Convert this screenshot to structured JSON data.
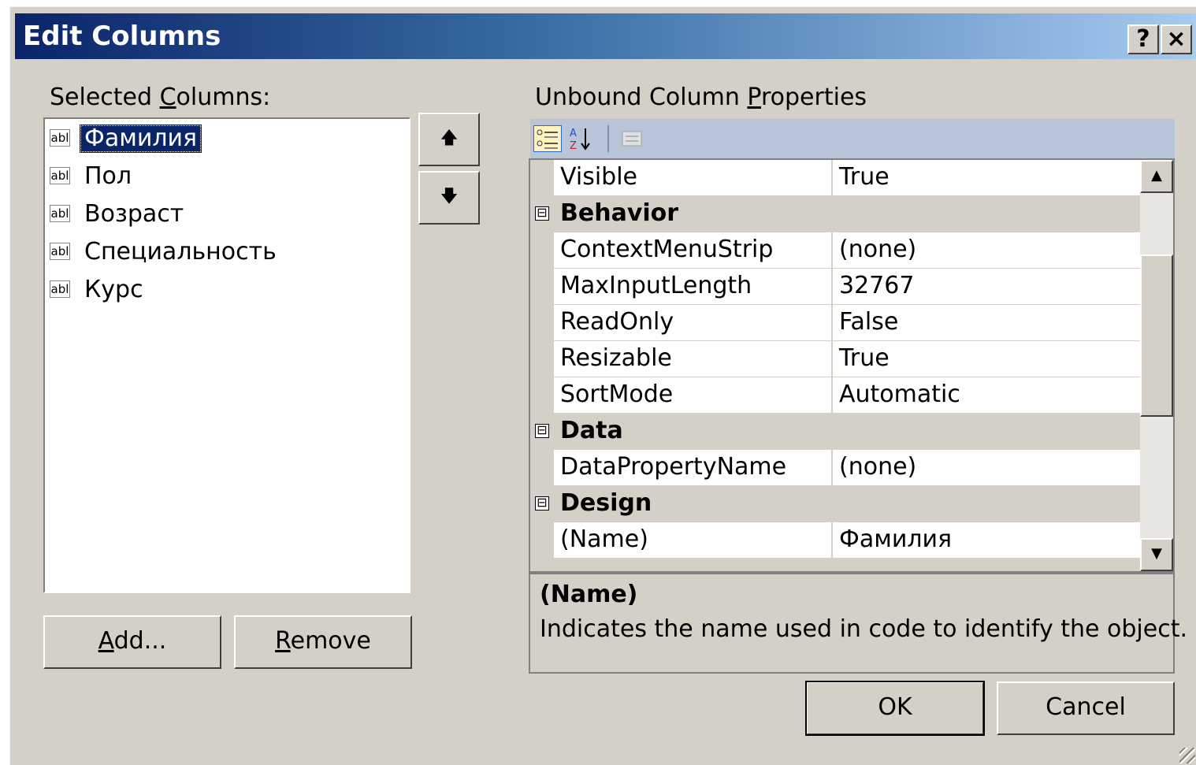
{
  "window": {
    "title": "Edit Columns",
    "help_label": "?",
    "close_label": "×"
  },
  "selected_columns": {
    "label_prefix": "Selected ",
    "label_mnemonic": "C",
    "label_suffix": "olumns:",
    "items": [
      {
        "icon": "abl",
        "label": "Фамилия",
        "selected": true
      },
      {
        "icon": "abl",
        "label": "Пол",
        "selected": false
      },
      {
        "icon": "abl",
        "label": "Возраст",
        "selected": false
      },
      {
        "icon": "abl",
        "label": "Специальность",
        "selected": false
      },
      {
        "icon": "abl",
        "label": "Курс",
        "selected": false
      }
    ]
  },
  "move_buttons": {
    "up_icon": "arrow-up-icon",
    "down_icon": "arrow-down-icon"
  },
  "list_buttons": {
    "add_mnemonic": "A",
    "add_rest": "dd...",
    "remove_mnemonic": "R",
    "remove_rest": "emove"
  },
  "properties": {
    "label_prefix": "Unbound Column ",
    "label_mnemonic": "P",
    "label_suffix": "roperties",
    "toolbar": [
      "categorized-icon",
      "alphabetical-icon",
      "property-pages-icon"
    ],
    "rows": [
      {
        "type": "prop",
        "name": "Visible",
        "value": "True"
      },
      {
        "type": "cat",
        "name": "Behavior",
        "toggle": "⊟"
      },
      {
        "type": "prop",
        "name": "ContextMenuStrip",
        "value": "(none)"
      },
      {
        "type": "prop",
        "name": "MaxInputLength",
        "value": "32767"
      },
      {
        "type": "prop",
        "name": "ReadOnly",
        "value": "False"
      },
      {
        "type": "prop",
        "name": "Resizable",
        "value": "True"
      },
      {
        "type": "prop",
        "name": "SortMode",
        "value": "Automatic"
      },
      {
        "type": "cat",
        "name": "Data",
        "toggle": "⊟"
      },
      {
        "type": "prop",
        "name": "DataPropertyName",
        "value": "(none)"
      },
      {
        "type": "cat",
        "name": "Design",
        "toggle": "⊟"
      },
      {
        "type": "prop",
        "name": "(Name)",
        "value": "Фамилия"
      }
    ],
    "scroll_up": "▲",
    "scroll_down": "▼"
  },
  "description": {
    "title": "(Name)",
    "body": "Indicates the name used in code to identify the object."
  },
  "footer": {
    "ok_label": "OK",
    "cancel_label": "Cancel"
  }
}
